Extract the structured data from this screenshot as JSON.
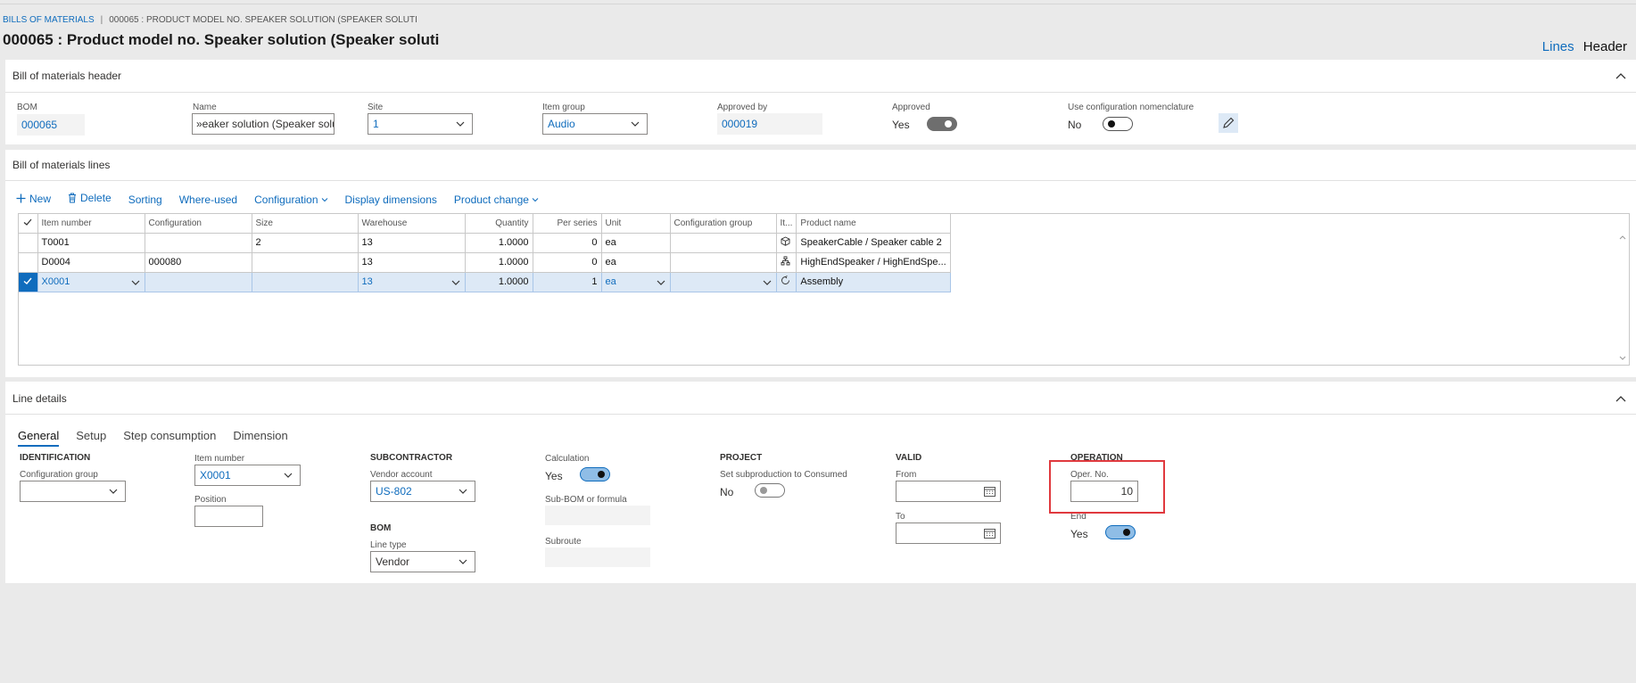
{
  "breadcrumb": {
    "root": "BILLS OF MATERIALS",
    "current": "000065 : PRODUCT MODEL NO. SPEAKER SOLUTION (SPEAKER SOLUTI"
  },
  "page_title": "000065 : Product model no. Speaker solution (Speaker soluti",
  "view_links": {
    "lines": "Lines",
    "header": "Header"
  },
  "header_section": {
    "title": "Bill of materials header",
    "bom_label": "BOM",
    "bom_value": "000065",
    "name_label": "Name",
    "name_value": "»eaker solution (Speaker solution)",
    "site_label": "Site",
    "site_value": "1",
    "item_group_label": "Item group",
    "item_group_value": "Audio",
    "approved_by_label": "Approved by",
    "approved_by_value": "000019",
    "approved_label": "Approved",
    "approved_value": "Yes",
    "use_config_label": "Use configuration nomenclature",
    "use_config_value": "No"
  },
  "lines_section": {
    "title": "Bill of materials lines",
    "toolbar": {
      "new": "New",
      "delete": "Delete",
      "sorting": "Sorting",
      "where_used": "Where-used",
      "configuration": "Configuration",
      "display_dimensions": "Display dimensions",
      "product_change": "Product change"
    },
    "columns": [
      "Item number",
      "Configuration",
      "Size",
      "Warehouse",
      "Quantity",
      "Per series",
      "Unit",
      "Configuration group",
      "It...",
      "Product name"
    ],
    "rows": [
      {
        "item": "T0001",
        "config": "",
        "size": "2",
        "warehouse": "13",
        "qty": "1.0000",
        "per_series": "0",
        "unit": "ea",
        "config_group": "",
        "icon": "box-icon",
        "product": "SpeakerCable / Speaker cable 2"
      },
      {
        "item": "D0004",
        "config": "000080",
        "size": "",
        "warehouse": "13",
        "qty": "1.0000",
        "per_series": "0",
        "unit": "ea",
        "config_group": "",
        "icon": "hierarchy-icon",
        "product": "HighEndSpeaker / HighEndSpe..."
      },
      {
        "item": "X0001",
        "config": "",
        "size": "",
        "warehouse": "13",
        "qty": "1.0000",
        "per_series": "1",
        "unit": "ea",
        "config_group": "",
        "icon": "cycle-icon",
        "product": "Assembly"
      }
    ]
  },
  "details_section": {
    "title": "Line details",
    "tabs": [
      "General",
      "Setup",
      "Step consumption",
      "Dimension"
    ],
    "identification": {
      "heading": "IDENTIFICATION",
      "config_group_label": "Configuration group",
      "config_group_value": ""
    },
    "item": {
      "item_number_label": "Item number",
      "item_number_value": "X0001",
      "position_label": "Position",
      "position_value": ""
    },
    "subcontractor": {
      "heading": "SUBCONTRACTOR",
      "vendor_label": "Vendor account",
      "vendor_value": "US-802"
    },
    "bom": {
      "heading": "BOM",
      "line_type_label": "Line type",
      "line_type_value": "Vendor"
    },
    "calculation": {
      "label": "Calculation",
      "value": "Yes",
      "sub_bom_label": "Sub-BOM or formula",
      "subroute_label": "Subroute"
    },
    "project": {
      "heading": "PROJECT",
      "set_sub_label": "Set subproduction to Consumed",
      "set_sub_value": "No"
    },
    "valid": {
      "heading": "VALID",
      "from_label": "From",
      "to_label": "To"
    },
    "operation": {
      "heading": "OPERATION",
      "oper_no_label": "Oper. No.",
      "oper_no_value": "10",
      "end_label": "End",
      "end_value": "Yes"
    }
  },
  "colors": {
    "accent": "#0f6cbd",
    "highlight_box": "#e0393e",
    "selected_row": "#dde9f6"
  }
}
